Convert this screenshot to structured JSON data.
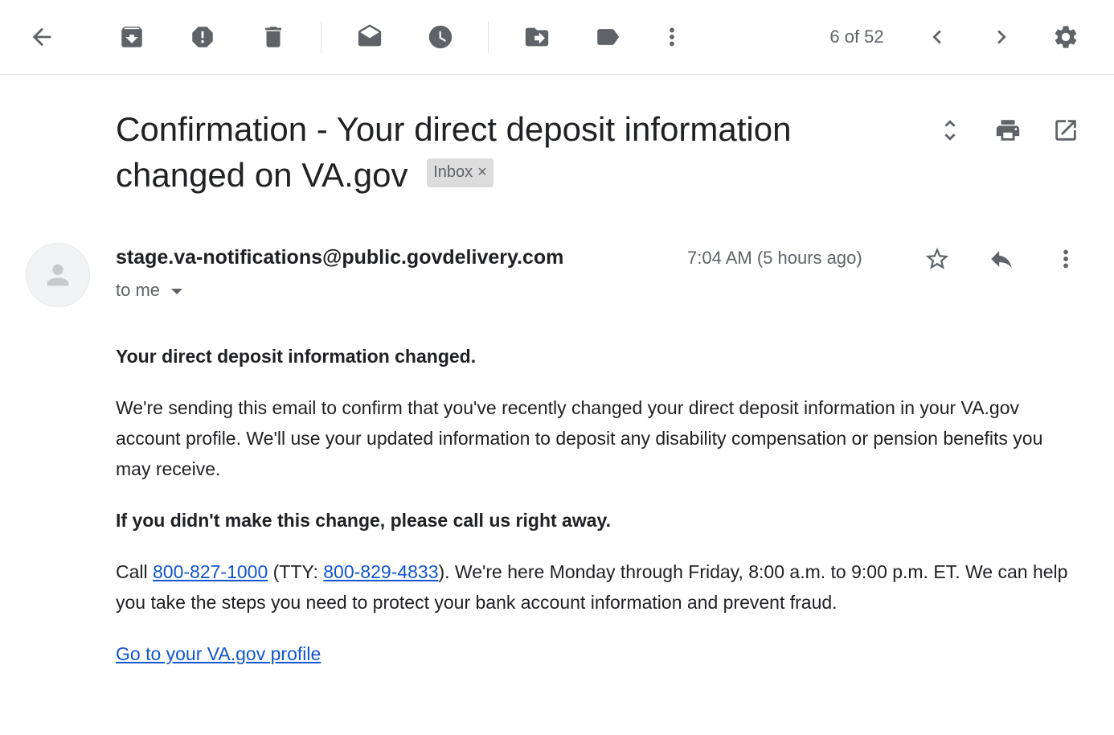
{
  "toolbar": {
    "icons": {
      "back": "arrow-back-icon",
      "archive": "archive-icon",
      "spam": "report-spam-icon",
      "delete": "delete-icon",
      "mark_unread": "mark-unread-icon",
      "snooze": "snooze-icon",
      "move": "move-to-icon",
      "labels": "label-icon",
      "more": "more-vert-icon",
      "older": "chevron-left-icon",
      "newer": "chevron-right-icon",
      "settings": "gear-icon"
    },
    "pager": "6 of 52"
  },
  "message": {
    "subject": "Confirmation - Your direct deposit information changed on VA.gov",
    "label": "Inbox",
    "label_remove": "×",
    "sender": "stage.va-notifications@public.govdelivery.com",
    "recipient": "to me",
    "time": "7:04 AM (5 hours ago)",
    "body": {
      "heading": "Your direct deposit information changed.",
      "paragraph1": "We're sending this email to confirm that you've recently changed your direct deposit information in your VA.gov account profile. We'll use your updated information to deposit any disability compensation or pension benefits you may receive.",
      "warning": "If you didn't make this change, please call us right away.",
      "call_prefix": "Call ",
      "phone": "800-827-1000",
      "tty_prefix": " (TTY: ",
      "tty_phone": "800-829-4833",
      "call_suffix": "). We're here Monday through Friday, 8:00 a.m. to 9:00 p.m. ET. We can help you take the steps you need to protect your bank account information and prevent fraud.",
      "profile_link": "Go to your VA.gov profile"
    }
  },
  "colors": {
    "link": "#1155cc",
    "icon": "#5f6368",
    "text": "#202124",
    "chip_bg": "#dcdcdc"
  }
}
